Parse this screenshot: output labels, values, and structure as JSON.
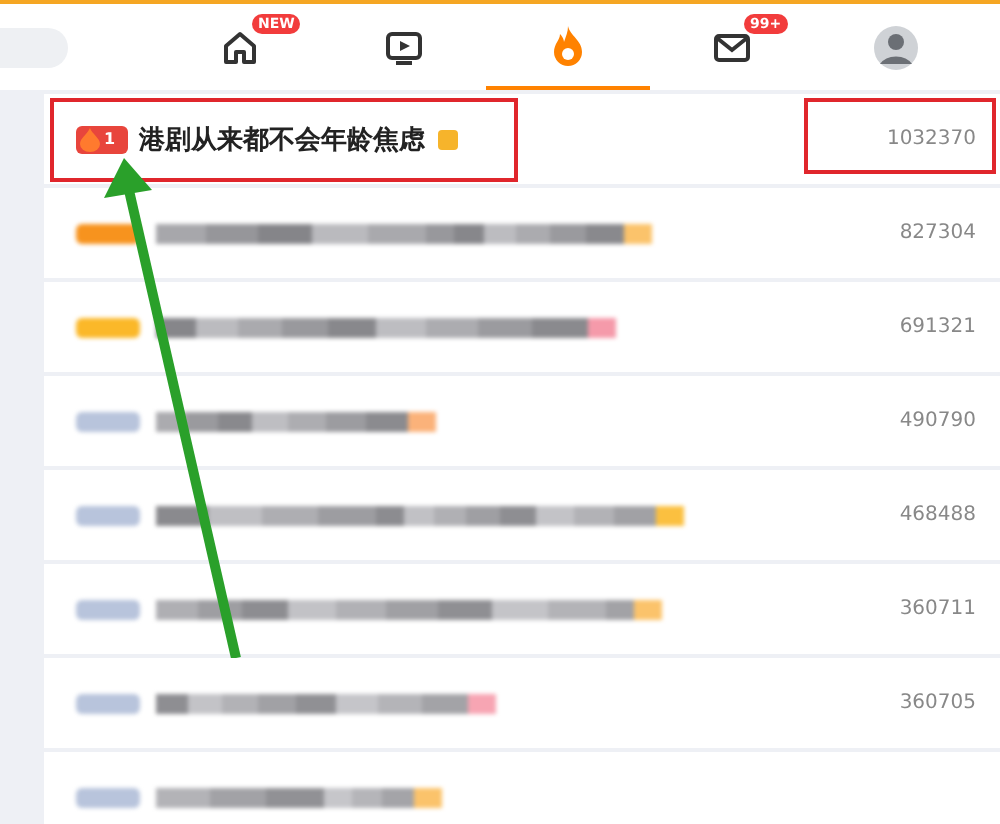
{
  "nav": {
    "tabs": [
      {
        "kind": "home",
        "badge": "NEW",
        "selected": false
      },
      {
        "kind": "video",
        "selected": false
      },
      {
        "kind": "hot",
        "selected": true
      },
      {
        "kind": "mail",
        "badge": "99+",
        "selected": false
      },
      {
        "kind": "avatar",
        "selected": false
      }
    ]
  },
  "hot_list": [
    {
      "kind": "clear",
      "rank": "1",
      "title": "港剧从来都不会年龄焦虑",
      "count": "1032370",
      "highlighted": true
    },
    {
      "kind": "blurred",
      "color": "#f7931e",
      "count": "827304",
      "highlighted": false
    },
    {
      "kind": "blurred",
      "color": "#fbb829",
      "count": "691321",
      "highlighted": false
    },
    {
      "kind": "blurred",
      "color": "#b8c4dc",
      "count": "490790",
      "highlighted": false
    },
    {
      "kind": "blurred",
      "color": "#b8c4dc",
      "count": "468488",
      "highlighted": false
    },
    {
      "kind": "blurred",
      "color": "#b8c4dc",
      "count": "360711",
      "highlighted": false
    },
    {
      "kind": "blurred",
      "color": "#b8c4dc",
      "count": "360705",
      "highlighted": false
    },
    {
      "kind": "blurred",
      "color": "#b8c4dc",
      "highlighted": false
    }
  ]
}
